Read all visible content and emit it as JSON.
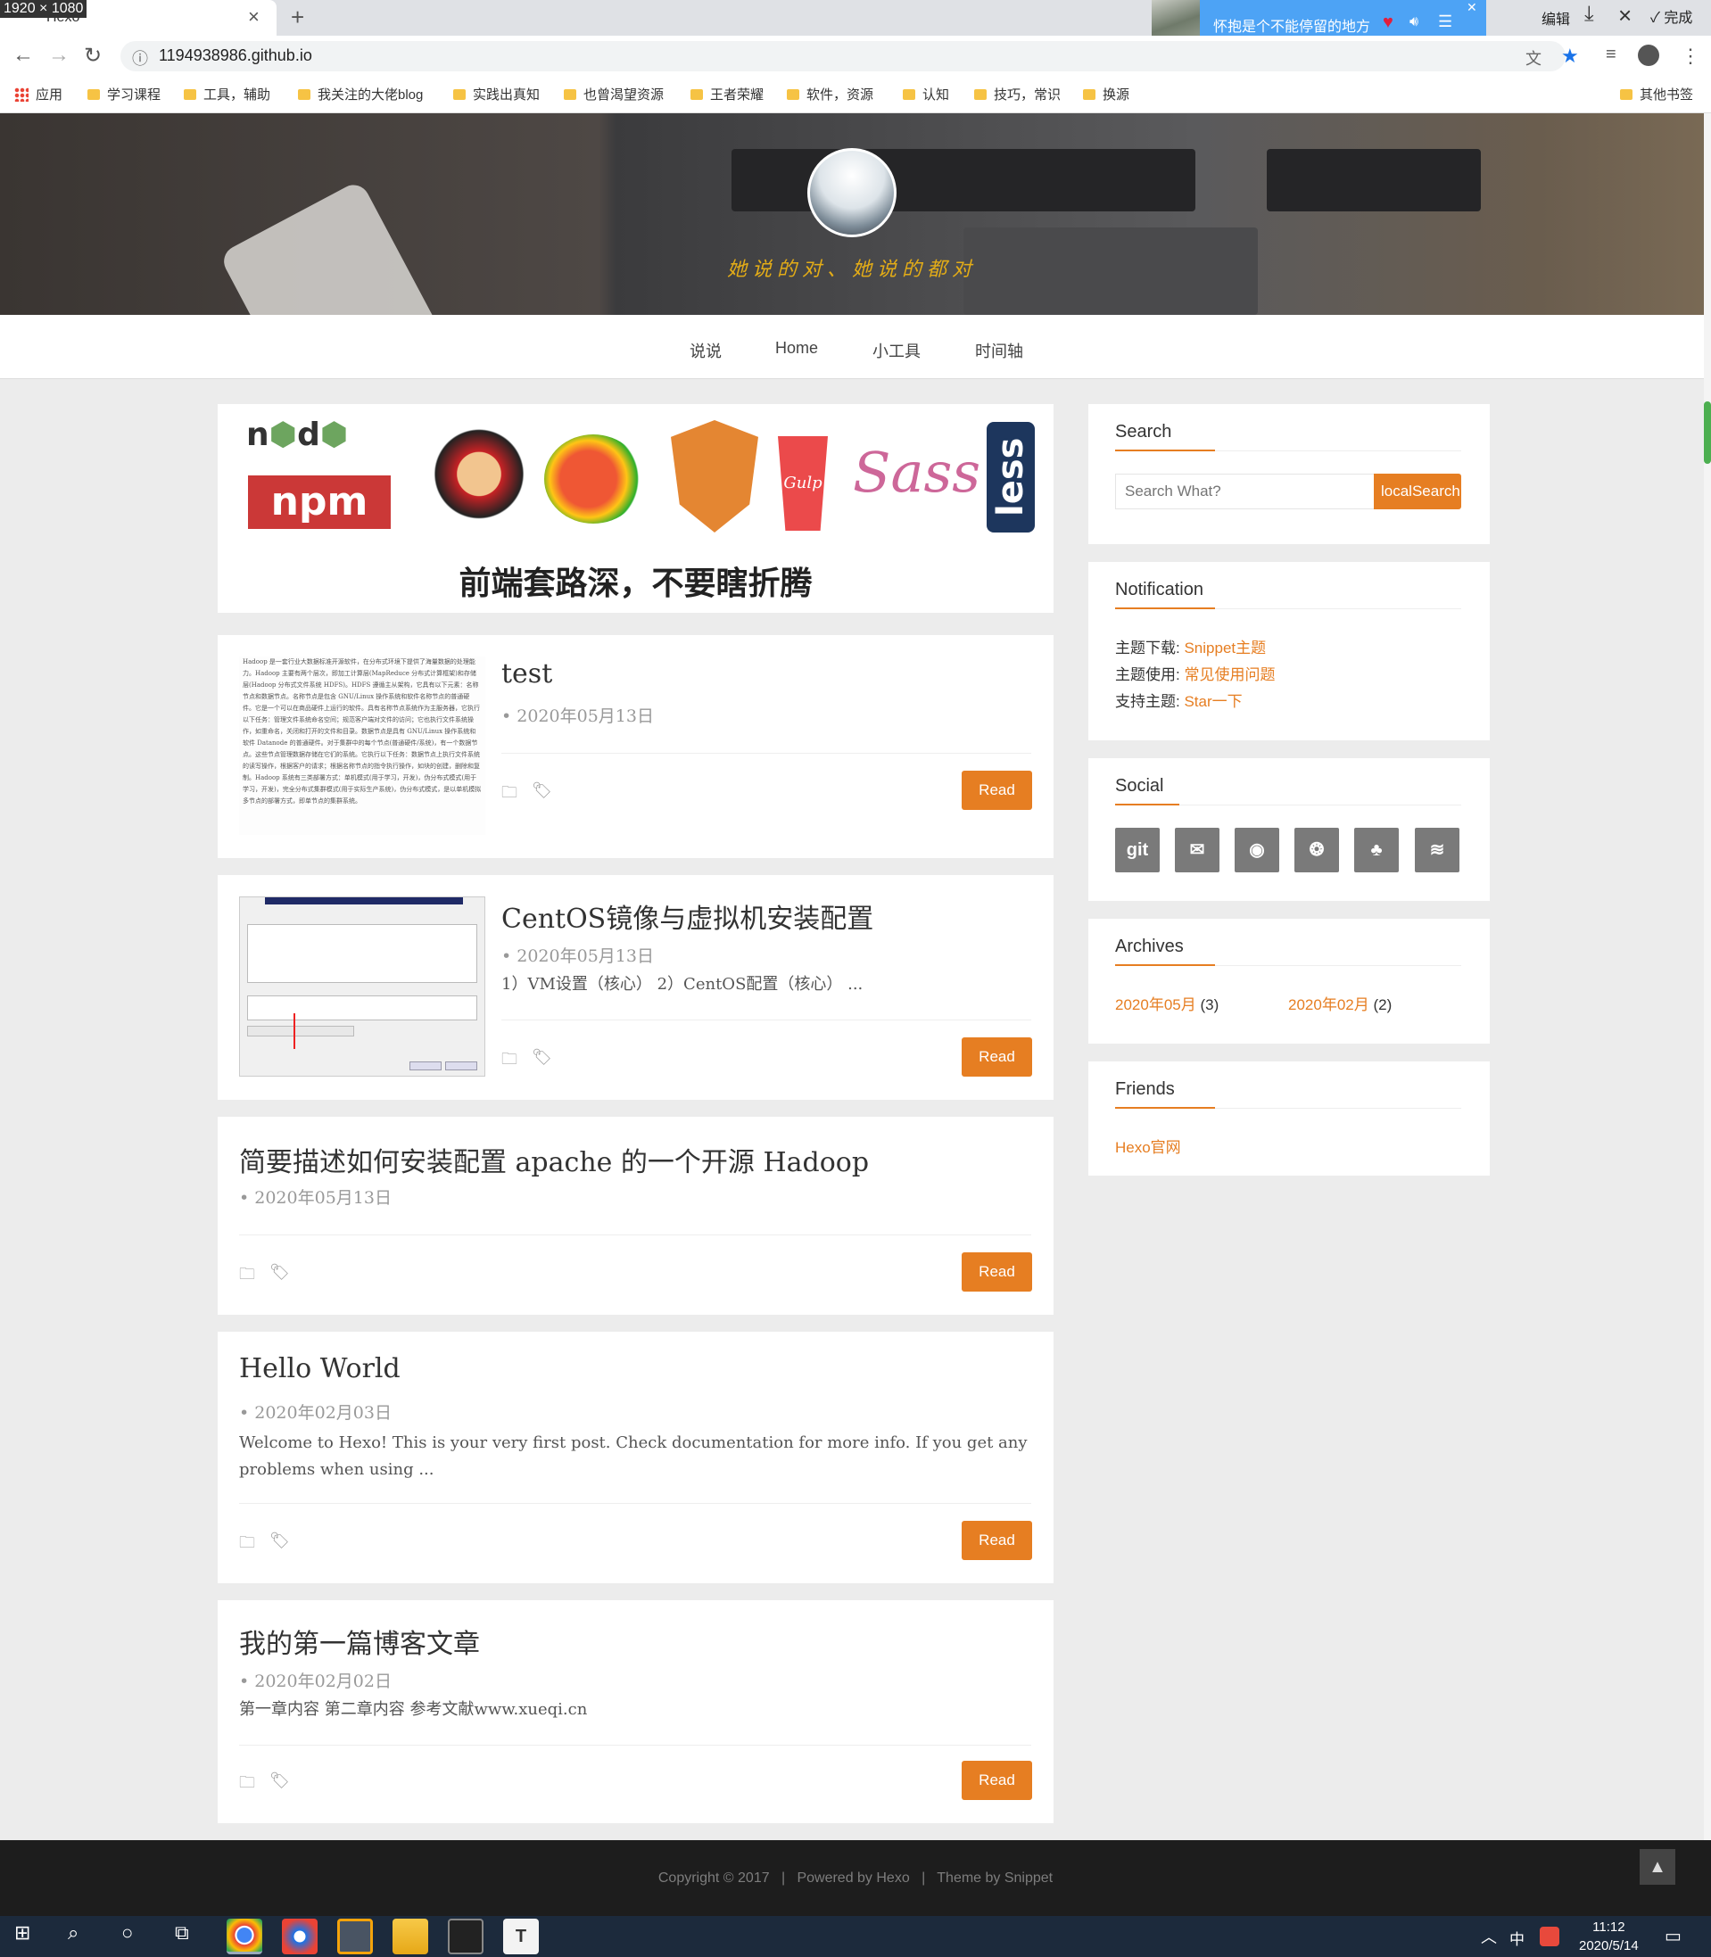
{
  "browser": {
    "screen_badge": "1920 × 1080",
    "tab_title": "Hexo",
    "url": "1194938986.github.io",
    "music_widget": {
      "title": "怀抱是个不能停留的地方"
    },
    "toolbar_actions": {
      "edit": "编辑",
      "done": "完成"
    },
    "bookmarks": [
      {
        "label": "应用",
        "kind": "apps"
      },
      {
        "label": "学习课程"
      },
      {
        "label": "工具，辅助"
      },
      {
        "label": "我关注的大佬blog"
      },
      {
        "label": "实践出真知"
      },
      {
        "label": "也曾渴望资源"
      },
      {
        "label": "王者荣耀"
      },
      {
        "label": "软件，资源"
      },
      {
        "label": "认知"
      },
      {
        "label": "技巧，常识"
      },
      {
        "label": "换源"
      },
      {
        "label": "其他书签"
      }
    ]
  },
  "header": {
    "motto": "她说的对、她说的都对"
  },
  "nav": {
    "items": [
      "说说",
      "Home",
      "小工具",
      "时间轴"
    ]
  },
  "promo": {
    "slogan": "前端套路深，不要瞎折腾",
    "logos": [
      "node",
      "npm",
      "yeoman",
      "bower",
      "grunt",
      "Gulp",
      "Sass",
      "less"
    ]
  },
  "posts": [
    {
      "title": "test",
      "date": "• 2020年05月13日",
      "excerpt": "",
      "thumbnail": "text",
      "thumbnail_text": "Hadoop 是一套行业大数据标准开源软件，在分布式环境下提供了海量数据的处理能力。Hadoop 主要有两个层次，即加工计算层(MapReduce 分布式计算框架)和存储层(Hadoop 分布式文件系统 HDFS)。HDFS 遵循主从架构，它具有以下元素：名称节点和数据节点。名称节点是包含 GNU/Linux 操作系统和软件名称节点的普通硬件。它是一个可以在商品硬件上运行的软件。具有名称节点系统作为主服务器，它执行以下任务：管理文件系统命名空间；规范客户端对文件的访问；它也执行文件系统操作，如重命名，关闭和打开的文件和目录。数据节点是具有 GNU/Linux 操作系统和软件 Datanode 的普通硬件。对于集群中的每个节点(普通硬件/系统)，有一个数据节点。这些节点管理数据存储在它们的系统。它执行以下任务：数据节点上执行文件系统的读写操作，根据客户的请求；根据名称节点的指令执行操作，如块的创建，删除和复制。Hadoop 系统有三类部署方式：单机模式(用于学习，开发)，伪分布式模式(用于学习，开发)，完全分布式集群模式(用于实际生产系统)，伪分布式模式，是以单机模拟多节点的部署方式，即单节点的集群系统。",
      "read": "Read"
    },
    {
      "title": "CentOS镜像与虚拟机安装配置",
      "date": "• 2020年05月13日",
      "excerpt": "1）VM设置（核心） 2）CentOS配置（核心） ...",
      "thumbnail": "screenshot",
      "read": "Read"
    },
    {
      "title": "简要描述如何安装配置 apache 的一个开源 Hadoop",
      "date": "• 2020年05月13日",
      "excerpt": "",
      "thumbnail": "none",
      "read": "Read"
    },
    {
      "title": "Hello World",
      "date": "• 2020年02月03日",
      "excerpt": "Welcome to Hexo! This is your very first post. Check documentation for more info. If you get any problems when using ...",
      "thumbnail": "none",
      "read": "Read"
    },
    {
      "title": "我的第一篇博客文章",
      "date": "• 2020年02月02日",
      "excerpt": "第一章内容 第二章内容 参考文献www.xueqi.cn",
      "thumbnail": "none",
      "read": "Read"
    }
  ],
  "sidebar": {
    "search": {
      "title": "Search",
      "placeholder": "Search What?",
      "button": "localSearch"
    },
    "notification": {
      "title": "Notification",
      "rows": [
        {
          "label": "主题下载:",
          "link": "Snippet主题"
        },
        {
          "label": "主题使用:",
          "link": "常见使用问题"
        },
        {
          "label": "支持主题:",
          "link": "Star一下"
        }
      ]
    },
    "social": {
      "title": "Social",
      "items": [
        {
          "name": "git",
          "glyph": "git"
        },
        {
          "name": "mail",
          "glyph": "✉"
        },
        {
          "name": "qq",
          "glyph": "◉"
        },
        {
          "name": "wechat",
          "glyph": "❂"
        },
        {
          "name": "group",
          "glyph": "♣"
        },
        {
          "name": "rss",
          "glyph": "≋"
        }
      ]
    },
    "archives": {
      "title": "Archives",
      "items": [
        {
          "month": "2020年05月",
          "count": "(3)"
        },
        {
          "month": "2020年02月",
          "count": "(2)"
        }
      ]
    },
    "friends": {
      "title": "Friends",
      "links": [
        "Hexo官网"
      ]
    }
  },
  "footer": {
    "text": "Copyright © 2017   |   Powered by Hexo   |   Theme by Snippet"
  },
  "taskbar": {
    "ime": "中",
    "time": "11:12",
    "date": "2020/5/14"
  },
  "colors": {
    "accent": "#e67e22",
    "footer_bg": "#1d1d1d",
    "page_bg": "#ececec"
  }
}
